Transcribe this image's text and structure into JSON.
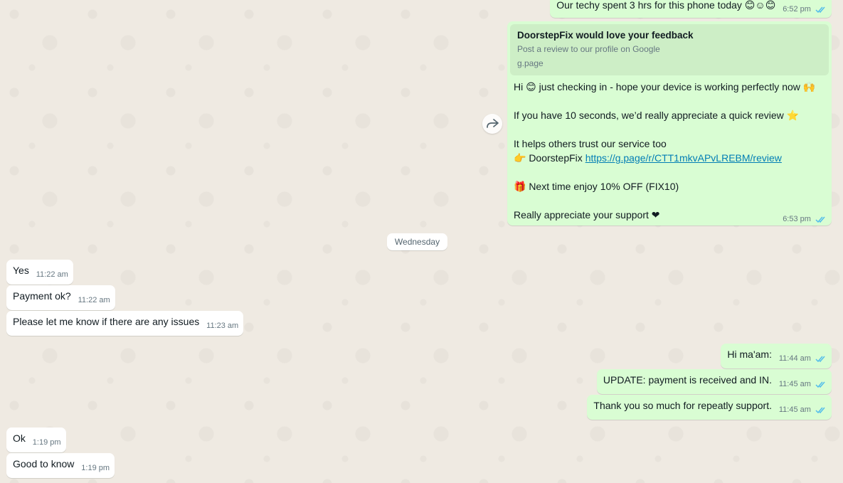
{
  "chat": {
    "date_separator": "Wednesday",
    "top_message": {
      "text": "Our techy spent 3 hrs for this phone today 😊☺😊",
      "time": "6:52 pm"
    },
    "review_message": {
      "preview_title": "DoorstepFix would love your feedback",
      "preview_desc": "Post a review to our profile on Google",
      "preview_domain": "g.page",
      "line1": "Hi 😊 just checking in - hope your device is working perfectly now 🙌",
      "line2": "If you have 10 seconds, we’d really appreciate a quick review ⭐",
      "line3": "It helps others trust our service too",
      "line4_prefix": "👉 DoorstepFix ",
      "link": "https://g.page/r/CTT1mkvAPvLREBM/review",
      "line5": "🎁 Next time enjoy 10% OFF (FIX10)",
      "line6": "Really appreciate your support ❤",
      "time": "6:53 pm"
    },
    "incoming_1": [
      {
        "text": "Yes",
        "time": "11:22 am"
      },
      {
        "text": "Payment ok?",
        "time": "11:22 am"
      },
      {
        "text": "Please let me know if there are any issues",
        "time": "11:23 am"
      }
    ],
    "outgoing_1": [
      {
        "text": "Hi ma'am:",
        "time": "11:44 am"
      },
      {
        "text": "UPDATE:  payment is received and IN.",
        "time": "11:45 am"
      },
      {
        "text": "Thank you so much for repeatly support.",
        "time": "11:45 am"
      }
    ],
    "incoming_2": [
      {
        "text": "Ok",
        "time": "1:19 pm"
      },
      {
        "text": "Good to know",
        "time": "1:19 pm"
      }
    ],
    "colors": {
      "background": "#efeae2",
      "outgoing_bubble": "#d9fdd3",
      "incoming_bubble": "#ffffff",
      "read_ticks": "#53bdeb"
    },
    "icons": {
      "forward": "forward-icon",
      "read_receipt": "double-check-icon"
    }
  }
}
